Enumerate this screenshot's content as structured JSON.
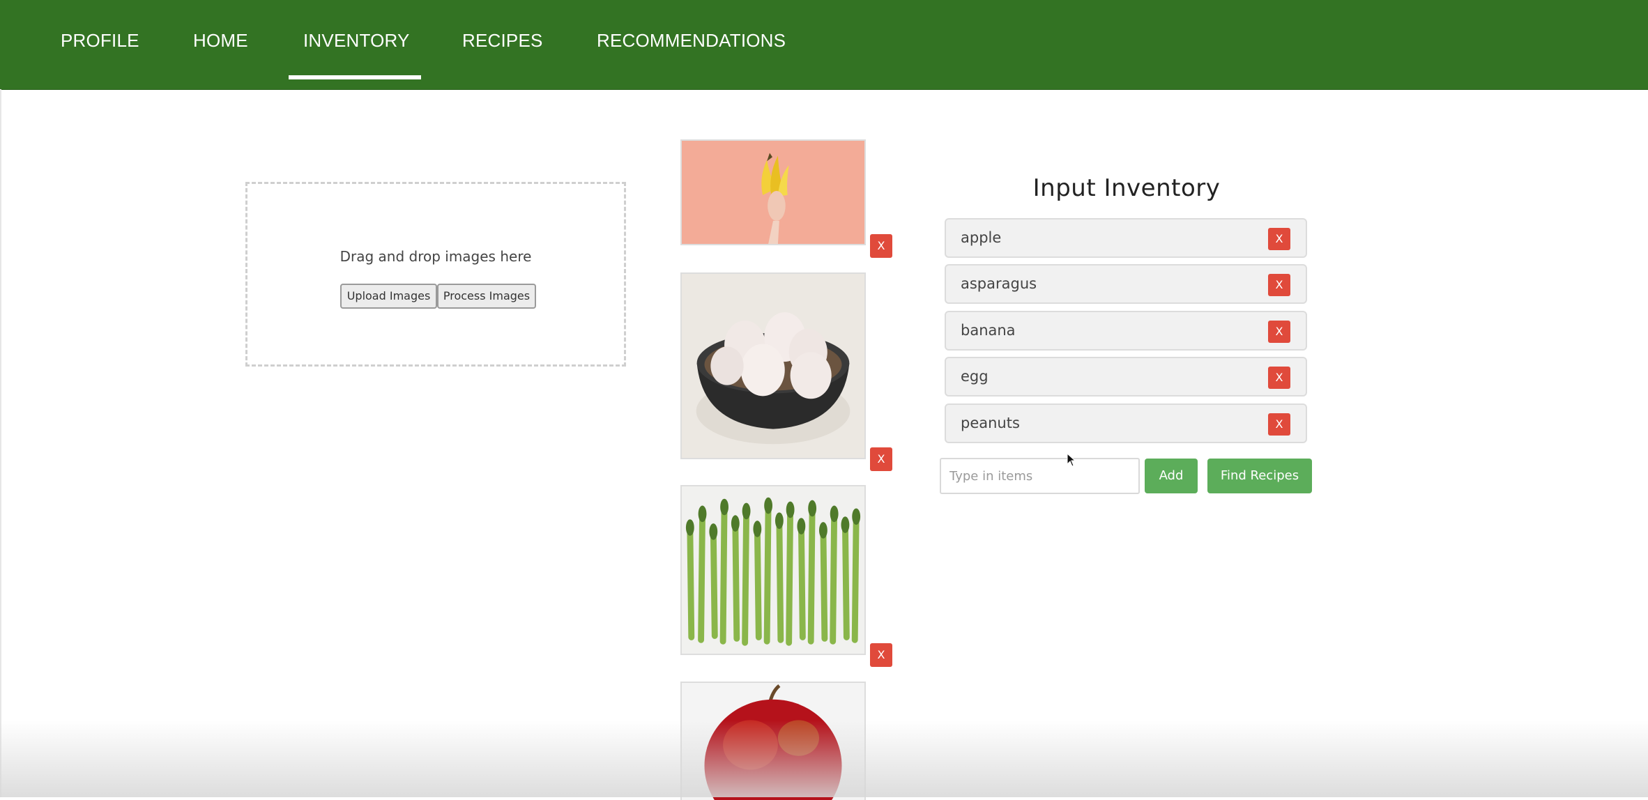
{
  "nav": {
    "items": [
      {
        "label": "PROFILE"
      },
      {
        "label": "HOME"
      },
      {
        "label": "INVENTORY"
      },
      {
        "label": "RECIPES"
      },
      {
        "label": "RECOMMENDATIONS"
      }
    ],
    "active": "INVENTORY"
  },
  "upload": {
    "drop_text": "Drag and drop images here",
    "upload_label": "Upload Images",
    "process_label": "Process Images"
  },
  "images": [
    {
      "subject": "banana",
      "delete_label": "X"
    },
    {
      "subject": "egg",
      "delete_label": "X"
    },
    {
      "subject": "asparagus",
      "delete_label": "X"
    },
    {
      "subject": "apple",
      "delete_label": ""
    }
  ],
  "inventory": {
    "title": "Input Inventory",
    "items": [
      {
        "label": "apple",
        "delete_label": "X"
      },
      {
        "label": "asparagus",
        "delete_label": "X"
      },
      {
        "label": "banana",
        "delete_label": "X"
      },
      {
        "label": "egg",
        "delete_label": "X"
      },
      {
        "label": "peanuts",
        "delete_label": "X"
      }
    ],
    "input_placeholder": "Type in items",
    "input_value": "",
    "add_label": "Add",
    "find_label": "Find Recipes"
  },
  "colors": {
    "nav_bg": "#337323",
    "accent_green": "#5cad5a",
    "delete_red": "#e04a3b"
  }
}
